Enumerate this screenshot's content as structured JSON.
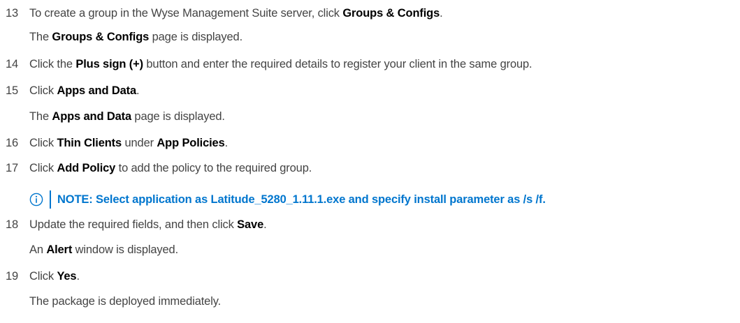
{
  "steps": [
    {
      "number": "13",
      "text": [
        "To create a group in the Wyse Management Suite server, click ",
        ""
      ],
      "bold": [
        "Groups & Configs",
        "."
      ],
      "result_pre": "The ",
      "result_bold": "Groups & Configs",
      "result_post": " page is displayed."
    },
    {
      "number": "14",
      "pre": "Click the ",
      "bold": "Plus sign (+)",
      "post": " button and enter the required details to register your client in the same group."
    },
    {
      "number": "15",
      "pre": "Click ",
      "bold": "Apps and Data",
      "post": ".",
      "result_pre": "The ",
      "result_bold": "Apps and Data",
      "result_post": " page is displayed."
    },
    {
      "number": "16",
      "pre": "Click ",
      "bold": "Thin Clients",
      "mid": " under ",
      "bold2": "App Policies",
      "post": "."
    },
    {
      "number": "17",
      "pre": "Click ",
      "bold": "Add Policy",
      "post": " to add the policy to the required group."
    },
    {
      "number": "18",
      "pre": "Update the required fields, and then click ",
      "bold": "Save",
      "post": ".",
      "result_pre": "An ",
      "result_bold": "Alert",
      "result_post": " window is displayed."
    },
    {
      "number": "19",
      "pre": "Click ",
      "bold": "Yes",
      "post": ".",
      "result": "The package is deployed immediately."
    }
  ],
  "note": {
    "icon": "info-icon",
    "text": "NOTE: Select application as Latitude_5280_1.11.1.exe and specify install parameter as /s /f.",
    "color": "#0076ce"
  }
}
